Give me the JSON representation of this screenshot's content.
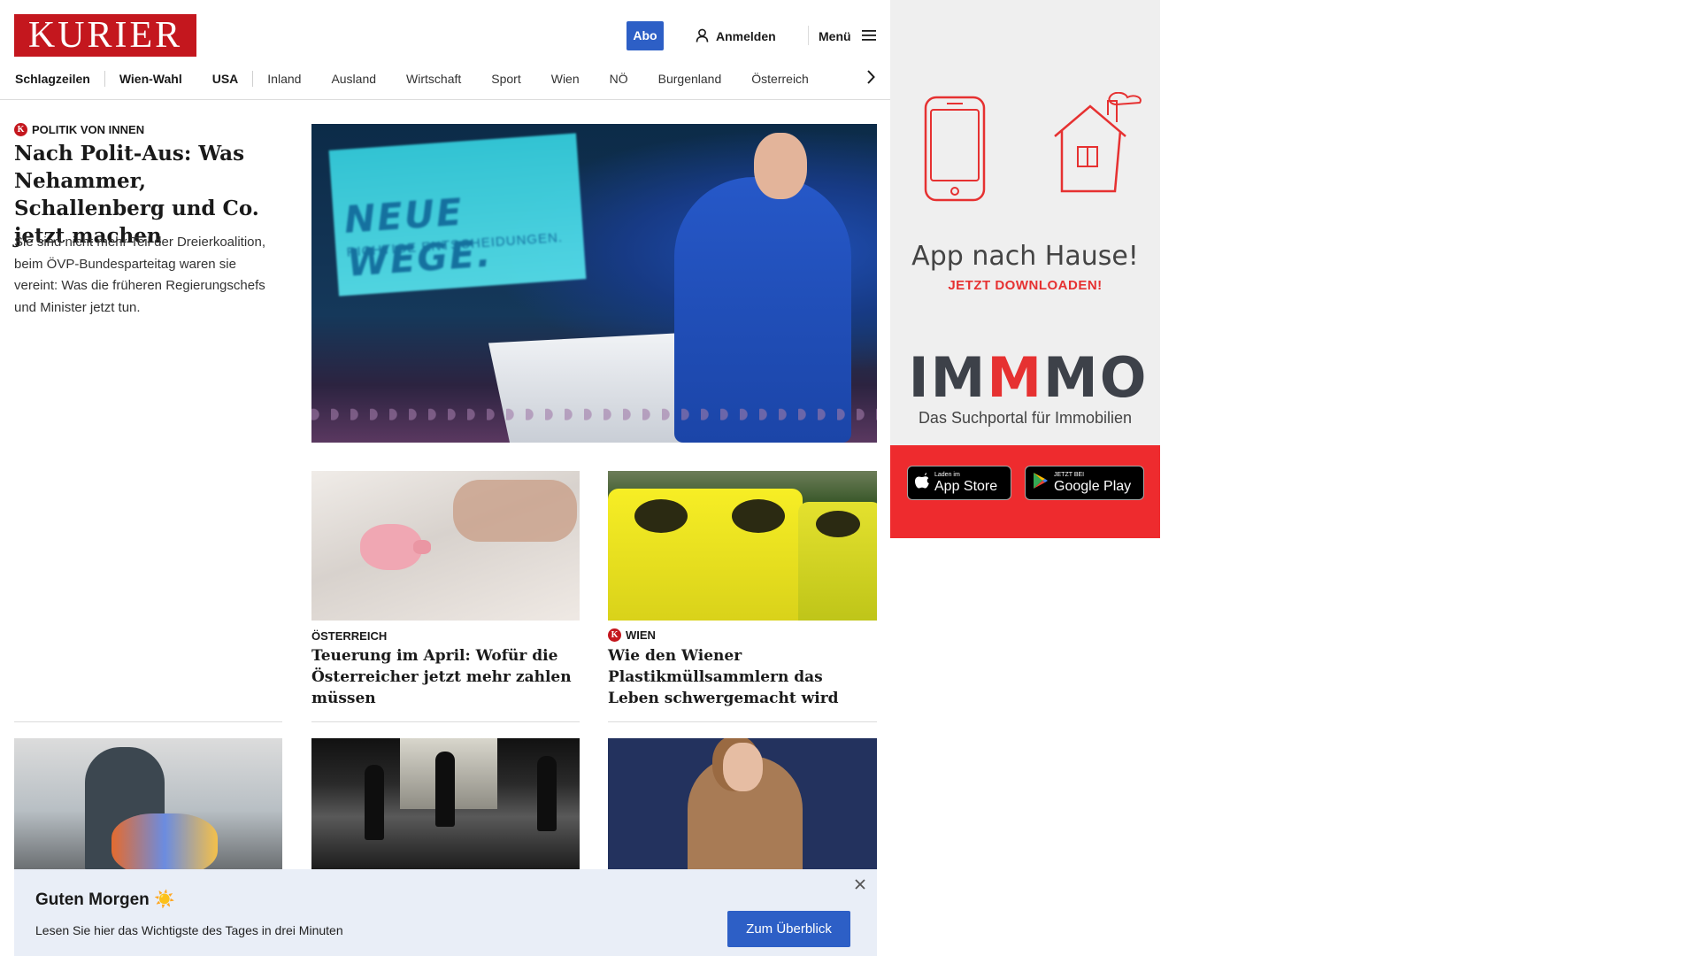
{
  "header": {
    "logo": "KURIER",
    "abo": "Abo",
    "login": "Anmelden",
    "menu": "Menü",
    "nav": [
      "Schlagzeilen",
      "Wien-Wahl",
      "USA",
      "Inland",
      "Ausland",
      "Wirtschaft",
      "Sport",
      "Wien",
      "NÖ",
      "Burgenland",
      "Österreich"
    ]
  },
  "lead": {
    "kicker": "POLITIK VON INNEN",
    "title": "Nach Polit-Aus: Was Nehammer, Schallenberg und Co. jetzt machen",
    "teaser": "Sie sind nicht mehr Teil der Dreierkoalition, beim ÖVP-Bundesparteitag waren sie vereint: Was die früheren Regierungschefs und Minister jetzt tun.",
    "image_text_1": "NEUE WEGE.",
    "image_text_2": "RICHTIGE ENTSCHEIDUNGEN."
  },
  "cards": [
    {
      "kicker": "ÖSTERREICH",
      "premium": false,
      "title": "Teuerung im April: Wofür die Österreicher jetzt mehr zahlen müssen"
    },
    {
      "kicker": "WIEN",
      "premium": true,
      "title": "Wie den Wiener Plastikmüllsammlern das Leben schwergemacht wird"
    }
  ],
  "banner": {
    "title": "Guten Morgen ☀️",
    "text": "Lesen Sie hier das Wichtigste des Tages in drei Minuten",
    "button": "Zum Überblick"
  },
  "ad": {
    "title": "App nach Hause!",
    "subtitle": "JETZT DOWNLOADEN!",
    "brand_1": "IM",
    "brand_red": "M",
    "brand_2": "MO",
    "brand_sub": "Das Suchportal für Immobilien",
    "appstore_small": "Laden im",
    "appstore_big": "App Store",
    "googleplay_small": "JETZT BEI",
    "googleplay_big": "Google Play"
  },
  "colors": {
    "brand_red": "#c4171e",
    "accent_blue": "#2d5fc6",
    "ad_red": "#ee2b2e",
    "banner_bg": "#e9eef7"
  }
}
